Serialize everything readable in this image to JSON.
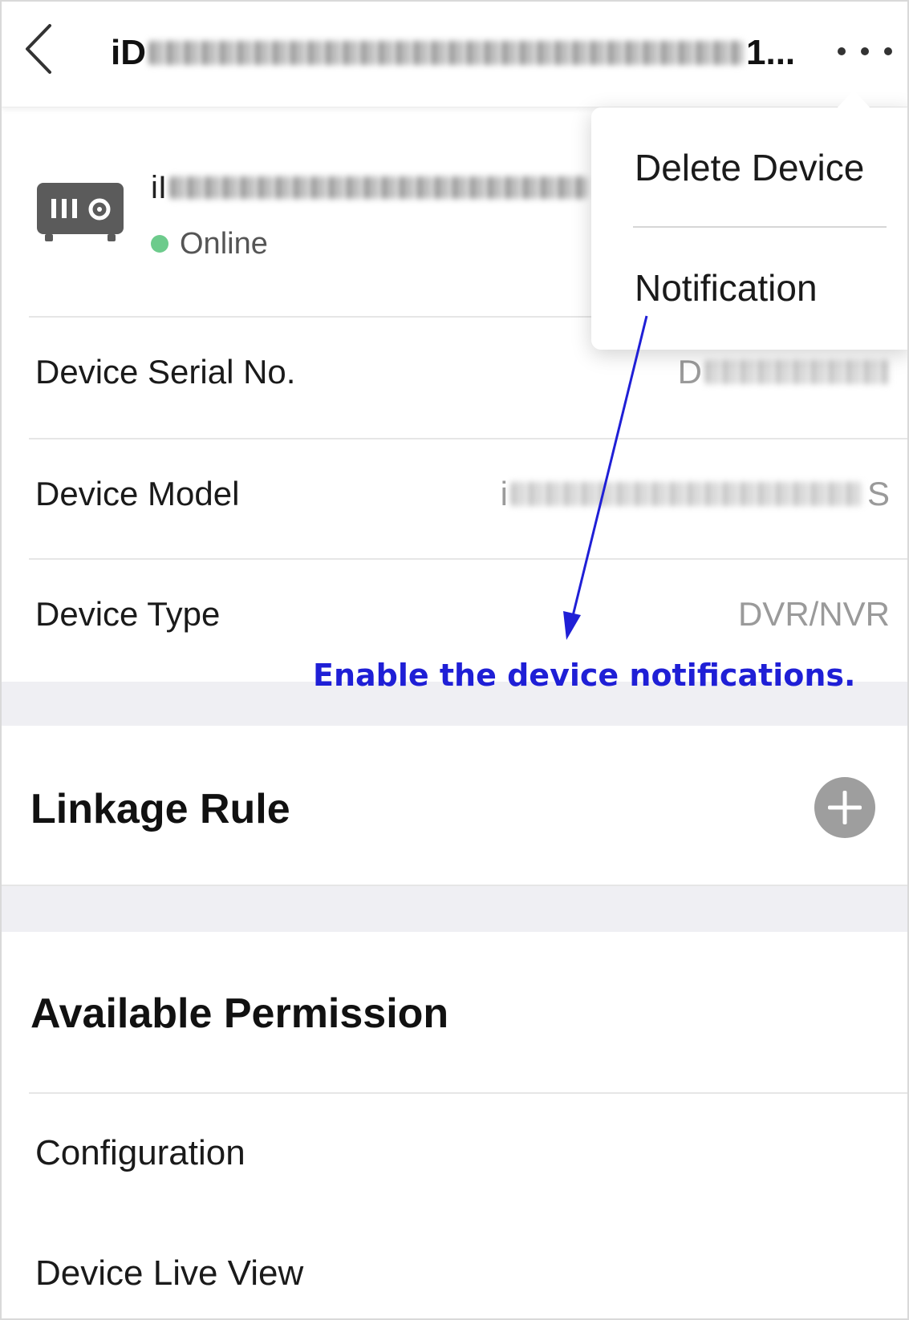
{
  "header": {
    "title_prefix": "iD",
    "title_suffix": "1..."
  },
  "device": {
    "name_prefix": "iI",
    "status": "Online",
    "status_color": "#6dcb8c"
  },
  "info_rows": [
    {
      "label": "Device Serial No.",
      "value_prefix": "D",
      "value_suffix": ""
    },
    {
      "label": "Device Model",
      "value_prefix": "i",
      "value_suffix": "S"
    },
    {
      "label": "Device Type",
      "value_prefix": "DVR/NVR",
      "value_suffix": ""
    }
  ],
  "sections": {
    "linkage_rule": "Linkage Rule",
    "available_permission": "Available Permission"
  },
  "permissions": [
    "Configuration",
    "Device Live View"
  ],
  "menu": {
    "delete_device": "Delete Device",
    "notification": "Notification"
  },
  "annotation": {
    "text": "Enable the device notifications.",
    "color": "#1f1fd6"
  },
  "icons": {
    "back": "chevron-left-icon",
    "more": "more-horizontal-icon",
    "device": "dvr-device-icon",
    "add": "plus-circle-icon"
  }
}
